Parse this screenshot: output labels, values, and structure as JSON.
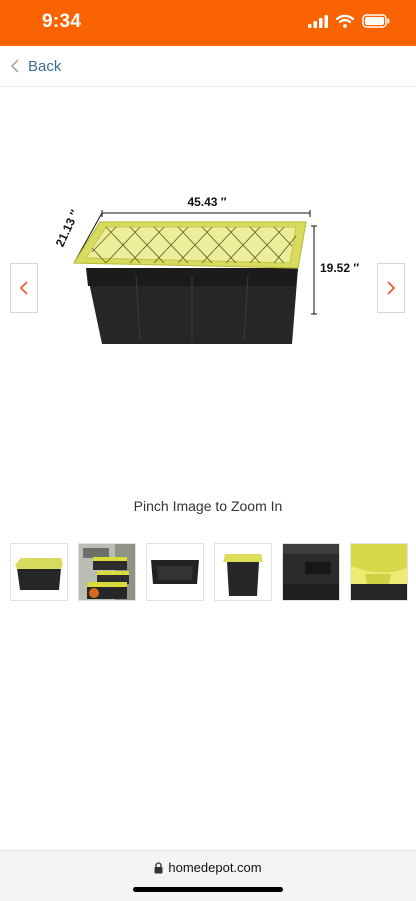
{
  "status_bar": {
    "time": "9:34",
    "background_color": "#f96302",
    "icons": [
      "signal-icon",
      "wifi-icon",
      "battery-icon"
    ]
  },
  "nav": {
    "back_label": "Back",
    "back_icon": "chevron-left-icon"
  },
  "product_image": {
    "dimensions": {
      "length": "45.43 ″",
      "depth": "21.13 ″",
      "height": "19.52 ″"
    },
    "prev_icon": "chevron-left-icon",
    "next_icon": "chevron-right-icon",
    "accent_color": "#e8622c"
  },
  "zoom_hint": "Pinch Image to Zoom In",
  "thumbnails": [
    {
      "name": "tote-side-view"
    },
    {
      "name": "totes-in-garage"
    },
    {
      "name": "tote-front-view"
    },
    {
      "name": "tote-end-view"
    },
    {
      "name": "tote-handle-closeup"
    },
    {
      "name": "lid-latch-closeup"
    }
  ],
  "browser": {
    "url": "homedepot.com",
    "lock_icon": "lock-icon"
  }
}
